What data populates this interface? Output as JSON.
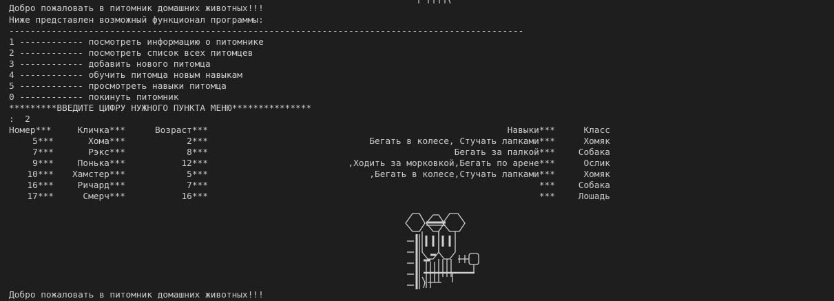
{
  "terminal": {
    "welcome": "Добро пожаловать в питомник домашних животных!!!",
    "intro": "Ниже представлен возможный функционал программы:",
    "separator": "-------------------------------------------------------------------------------------------------",
    "menu": [
      "1 ------------ посмотреть информацию о питомнике",
      "2 ------------ посмотреть список всех питомцев",
      "3 ------------ добавить нового питомца",
      "4 ------------ обучить питомца новым навыкам",
      "5 ------------ просмотреть навыки питомца",
      "0 ------------ покинуть питомник"
    ],
    "prompt": "*********ВВЕДИТЕ ЦИФРУ НУЖНОГО ПУНКТА МЕНЮ***************",
    "input": ":  2",
    "table": {
      "headers": {
        "number": "Номер***",
        "name": "Кличка***",
        "age": "Возраст***",
        "skills": "Навыки***",
        "class": "Класс"
      },
      "rows": [
        {
          "number": "5***",
          "name": "Хома***",
          "age": "2***",
          "skills": "Бегать в колесе, Стучать лапками***",
          "class": "Хомяк"
        },
        {
          "number": "7***",
          "name": "Рэкс***",
          "age": "8***",
          "skills": "Бегать за палкой***",
          "class": "Собака"
        },
        {
          "number": "9***",
          "name": "Понька***",
          "age": "12***",
          "skills": ",Ходить за морковкой,Бегать по арене***",
          "class": "Ослик"
        },
        {
          "number": "10***",
          "name": "Хамстер***",
          "age": "5***",
          "skills": ",Бегать в колесе,Стучать лапками***",
          "class": "Хомяк"
        },
        {
          "number": "16***",
          "name": "Ричард***",
          "age": "7***",
          "skills": "***",
          "class": "Собака"
        },
        {
          "number": "17***",
          "name": "Смерч***",
          "age": "16***",
          "skills": "***",
          "class": "Лошадь"
        }
      ]
    },
    "welcome_repeat": "Добро пожаловать в питомник домашних животных!!!"
  }
}
